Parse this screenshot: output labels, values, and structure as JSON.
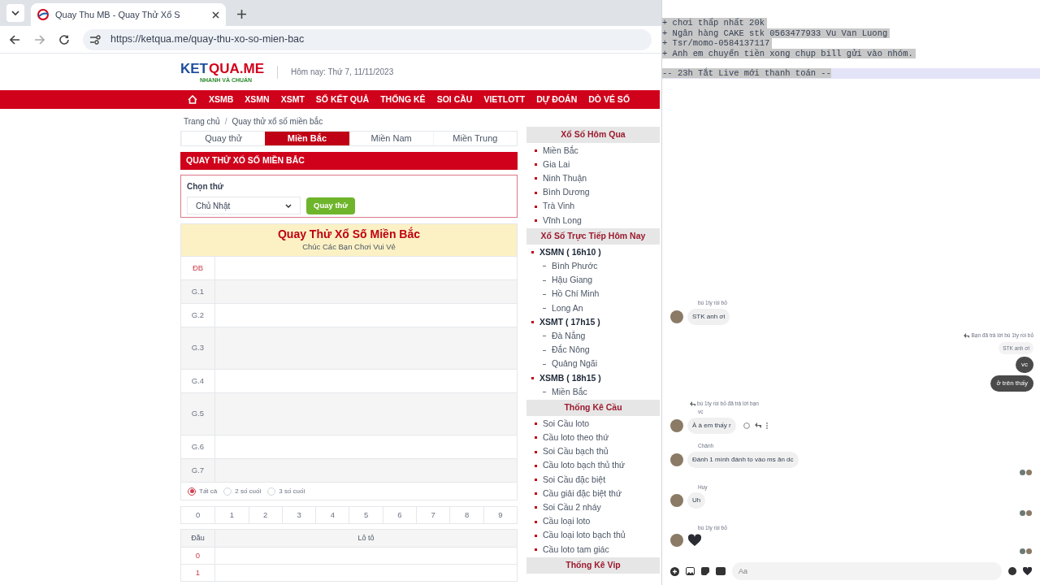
{
  "browser": {
    "tab_title": "Quay Thu MB - Quay Thử Xổ S",
    "url": "https://ketqua.me/quay-thu-xo-so-mien-bac"
  },
  "site": {
    "logo_left": "KET",
    "logo_right": "QUA.ME",
    "tagline": "NHANH VÀ CHUẨN",
    "date": "Hôm nay: Thứ 7, 11/11/2023"
  },
  "nav": [
    "XSMB",
    "XSMN",
    "XSMT",
    "SỐ KẾT QUẢ",
    "THỐNG KÊ",
    "SOI CẦU",
    "VIETLOTT",
    "DỰ ĐOÁN",
    "DÒ VÉ SỐ"
  ],
  "breadcrumb": [
    "Trang chủ",
    "Quay thử xổ số miền bắc"
  ],
  "breadcrumb_separator": "/",
  "tabs": [
    {
      "label": "Quay thử",
      "selected": false
    },
    {
      "label": "Miền Bắc",
      "selected": true
    },
    {
      "label": "Miền Nam",
      "selected": false
    },
    {
      "label": "Miền Trung",
      "selected": false
    }
  ],
  "section_title": "QUAY THỬ XỔ SỐ MIỀN BẮC",
  "form": {
    "label": "Chọn thứ",
    "select_value": "Chủ Nhật",
    "button": "Quay thử"
  },
  "results": {
    "title": "Quay Thử Xổ Số Miền Bắc",
    "subtitle": "Chúc Các Bạn Chơi Vui Vẻ",
    "rows": [
      {
        "label": "ĐB",
        "kind": "special"
      },
      {
        "label": "G.1",
        "kind": "normal"
      },
      {
        "label": "G.2",
        "kind": "normal"
      },
      {
        "label": "G.3",
        "kind": "tall"
      },
      {
        "label": "G.4",
        "kind": "normal"
      },
      {
        "label": "G.5",
        "kind": "tall"
      },
      {
        "label": "G.6",
        "kind": "normal"
      },
      {
        "label": "G.7",
        "kind": "normal"
      }
    ]
  },
  "filters": [
    {
      "label": "Tất cả",
      "selected": true
    },
    {
      "label": "2 số cuối",
      "selected": false
    },
    {
      "label": "3 số cuối",
      "selected": false
    }
  ],
  "digits": [
    "0",
    "1",
    "2",
    "3",
    "4",
    "5",
    "6",
    "7",
    "8",
    "9"
  ],
  "loto": {
    "columns": [
      "Đầu",
      "Lô tô"
    ],
    "rows": [
      "0",
      "1"
    ]
  },
  "sidebar": [
    {
      "title": "Xổ Số Hôm Qua",
      "items": [
        {
          "label": "Miền Bắc",
          "kind": "link"
        },
        {
          "label": "Gia Lai",
          "kind": "link"
        },
        {
          "label": "Ninh Thuận",
          "kind": "link"
        },
        {
          "label": "Bình Dương",
          "kind": "link"
        },
        {
          "label": "Trà Vinh",
          "kind": "link"
        },
        {
          "label": "Vĩnh Long",
          "kind": "link"
        }
      ]
    },
    {
      "title": "Xổ Số Trực Tiếp Hôm Nay",
      "items": [
        {
          "label": "XSMN ( 16h10 )",
          "kind": "group"
        },
        {
          "label": "Bình Phước",
          "kind": "sub"
        },
        {
          "label": "Hậu Giang",
          "kind": "sub"
        },
        {
          "label": "Hồ Chí Minh",
          "kind": "sub"
        },
        {
          "label": "Long An",
          "kind": "sub"
        },
        {
          "label": "XSMT ( 17h15 )",
          "kind": "group"
        },
        {
          "label": "Đà Nẵng",
          "kind": "sub"
        },
        {
          "label": "Đắc Nông",
          "kind": "sub"
        },
        {
          "label": "Quảng Ngãi",
          "kind": "sub"
        },
        {
          "label": "XSMB ( 18h15 )",
          "kind": "group"
        },
        {
          "label": "Miền Bắc",
          "kind": "sub"
        }
      ]
    },
    {
      "title": "Thống Kê Cầu",
      "items": [
        {
          "label": "Soi Cầu loto",
          "kind": "link"
        },
        {
          "label": "Cầu loto theo thứ",
          "kind": "link"
        },
        {
          "label": "Soi Cầu bạch thủ",
          "kind": "link"
        },
        {
          "label": "Cầu loto bạch thủ thứ",
          "kind": "link"
        },
        {
          "label": "Soi Cầu đặc biệt",
          "kind": "link"
        },
        {
          "label": "Cầu giải đặc biệt thứ",
          "kind": "link"
        },
        {
          "label": "Soi Cầu 2 nháy",
          "kind": "link"
        },
        {
          "label": "Cầu loại loto",
          "kind": "link"
        },
        {
          "label": "Cầu loại loto bạch thủ",
          "kind": "link"
        },
        {
          "label": "Cầu loto tam giác",
          "kind": "link"
        }
      ]
    },
    {
      "title": "Thống Kê Vip"
    }
  ],
  "notes": {
    "lines": [
      "+ chơi thấp nhất 20k",
      "+ Ngân hàng CAKE stk 0563477933 Vu Van Luong",
      "+ Tsr/momo-0584137117",
      "+ Anh em chuyển tiền xong chụp bill gửi vào nhóm."
    ],
    "footer": "-- 23h Tắt Live mới thanh toán --"
  },
  "chat": {
    "messages": [
      {
        "kind": "incoming",
        "sender": "bú 1ty rồi bỏ",
        "text": "STK anh ơi"
      },
      {
        "kind": "outgoing",
        "reply_note": "Bạn đã trả lời bú 1ty rồi bỏ",
        "quote": "STK anh ơi",
        "bubbles": [
          "vc",
          "ở trên thấy"
        ]
      },
      {
        "kind": "reply",
        "reply_note": "bú 1ty rồi bỏ đã trả lời bạn",
        "quote": "vc",
        "text": "À à em thấy r"
      },
      {
        "kind": "incoming",
        "sender": "Chảnh",
        "text": "Đánh 1 mình đánh to vào ms ăn dc",
        "receipts": true
      },
      {
        "kind": "incoming",
        "sender": "Huy",
        "text": "Uh",
        "receipts": true
      },
      {
        "kind": "heart",
        "sender": "bú 1ty rồi bỏ",
        "receipts": true
      }
    ],
    "composer_placeholder": "Aa"
  }
}
